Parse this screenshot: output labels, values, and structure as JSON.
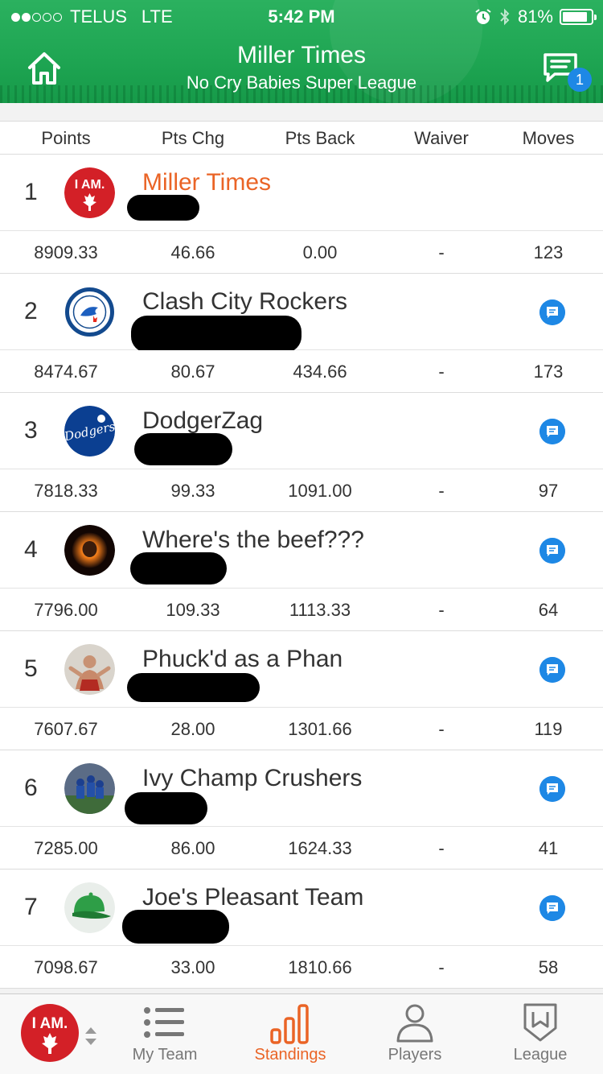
{
  "status_bar": {
    "carrier": "TELUS",
    "network": "LTE",
    "time": "5:42 PM",
    "battery": "81%",
    "battery_level": 0.81
  },
  "header": {
    "title": "Miller Times",
    "subtitle": "No Cry Babies Super League",
    "message_badge": "1"
  },
  "columns": [
    "Points",
    "Pts Chg",
    "Pts Back",
    "Waiver",
    "Moves"
  ],
  "teams": [
    {
      "rank": "1",
      "name": "Miller Times",
      "logo": "i-am-canada-logo",
      "points": "8909.33",
      "pts_chg": "46.66",
      "pts_back": "0.00",
      "waiver": "-",
      "moves": "123",
      "is_mine": true
    },
    {
      "rank": "2",
      "name": "Clash City Rockers",
      "logo": "toronto-blue-jays-logo",
      "points": "8474.67",
      "pts_chg": "80.67",
      "pts_back": "434.66",
      "waiver": "-",
      "moves": "173",
      "is_mine": false
    },
    {
      "rank": "3",
      "name": "DodgerZag",
      "logo": "dodgers-logo",
      "points": "7818.33",
      "pts_chg": "99.33",
      "pts_back": "1091.00",
      "waiver": "-",
      "moves": "97",
      "is_mine": false
    },
    {
      "rank": "4",
      "name": "Where's the beef???",
      "logo": "flaming-skull-logo",
      "points": "7796.00",
      "pts_chg": "109.33",
      "pts_back": "1113.33",
      "waiver": "-",
      "moves": "64",
      "is_mine": false
    },
    {
      "rank": "5",
      "name": "Phuck'd as a Phan",
      "logo": "hockey-player-photo",
      "points": "7607.67",
      "pts_chg": "28.00",
      "pts_back": "1301.66",
      "waiver": "-",
      "moves": "119",
      "is_mine": false
    },
    {
      "rank": "6",
      "name": "Ivy Champ Crushers",
      "logo": "cubs-celebration-photo",
      "points": "7285.00",
      "pts_chg": "86.00",
      "pts_back": "1624.33",
      "waiver": "-",
      "moves": "41",
      "is_mine": false
    },
    {
      "rank": "7",
      "name": "Joe's Pleasant Team",
      "logo": "green-cap-logo",
      "points": "7098.67",
      "pts_chg": "33.00",
      "pts_back": "1810.66",
      "waiver": "-",
      "moves": "58",
      "is_mine": false
    }
  ],
  "tabbar": {
    "my_team": "My Team",
    "standings": "Standings",
    "players": "Players",
    "league": "League",
    "active": "standings"
  },
  "colors": {
    "header_green": "#1fa653",
    "accent_orange": "#ea6426",
    "chat_blue": "#1e88e5",
    "team_logo_red": "#d32027"
  }
}
